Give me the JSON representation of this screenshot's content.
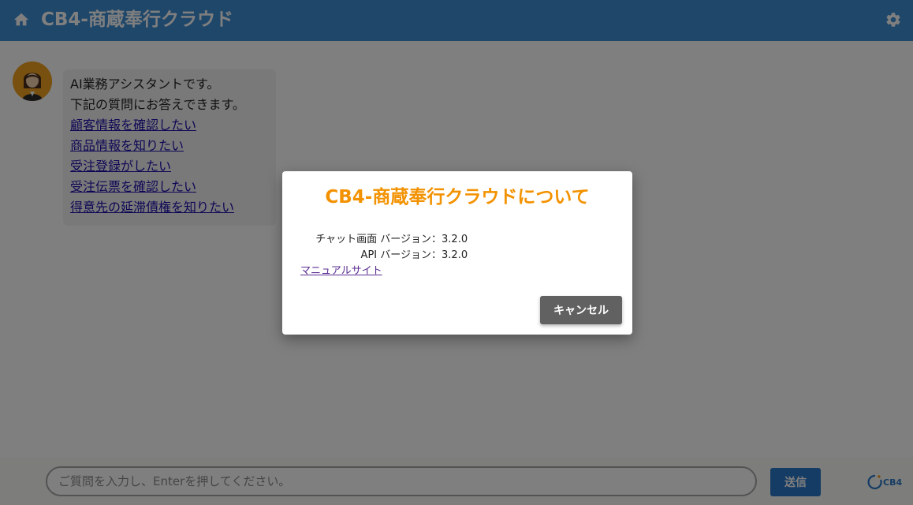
{
  "header": {
    "title": "CB4-商蔵奉行クラウド",
    "home_icon": "home-icon",
    "settings_icon": "gear-icon",
    "bg_color": "#3f8fd4"
  },
  "chat": {
    "assistant_message": {
      "lines": [
        "AI業務アシスタントです。",
        "下記の質問にお答えできます。"
      ],
      "links": [
        "顧客情報を確認したい",
        "商品情報を知りたい",
        "受注登録がしたい",
        "受注伝票を確認したい",
        "得意先の延滞債権を知りたい"
      ]
    }
  },
  "footer": {
    "input_placeholder": "ご質問を入力し、Enterを押してください。",
    "input_value": "",
    "send_label": "送信",
    "brand_logo_text": "CB4"
  },
  "dialog": {
    "title": "CB4-商蔵奉行クラウドについて",
    "versions": [
      {
        "label": "チャット画面 バージョン",
        "separator": "：",
        "value": "3.2.0"
      },
      {
        "label": "API バージョン",
        "separator": "：",
        "value": "3.2.0"
      }
    ],
    "manual_link": "マニュアルサイト",
    "cancel_label": "キャンセル",
    "title_color": "#f39200"
  }
}
